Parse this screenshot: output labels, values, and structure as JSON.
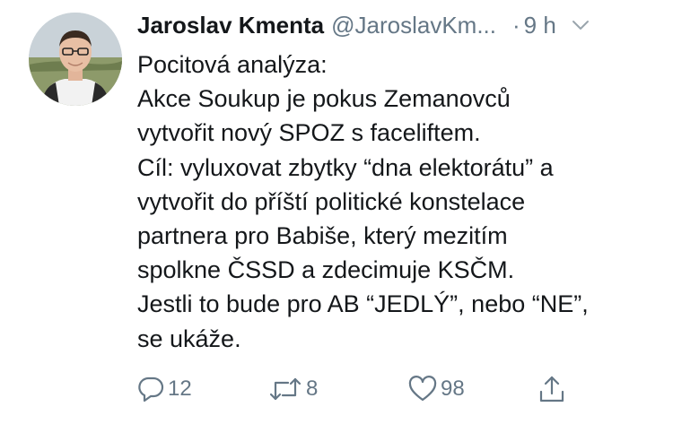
{
  "tweet": {
    "author_name": "Jaroslav Kmenta",
    "author_handle": "@JaroslavKm...",
    "separator": "·",
    "time": "9 h",
    "lines": [
      "Pocitová analýza:",
      "Akce Soukup je pokus Zemanovců",
      "vytvořit nový SPOZ s faceliftem.",
      "Cíl: vyluxovat zbytky “dna elektorátu” a",
      "vytvořit do příští politické konstelace",
      "partnera pro Babiše, který mezitím",
      "spolkne ČSSD a zdecimuje KSČM.",
      "Jestli to bude pro AB “JEDLÝ”, nebo “NE”,",
      "se ukáže."
    ]
  },
  "actions": {
    "reply_count": "12",
    "retweet_count": "8",
    "like_count": "98"
  },
  "icons": {
    "reply": "reply-icon",
    "retweet": "retweet-icon",
    "like": "heart-icon",
    "share": "share-icon",
    "menu": "chevron-down-icon"
  },
  "colors": {
    "text": "#14171a",
    "secondary": "#657786"
  }
}
